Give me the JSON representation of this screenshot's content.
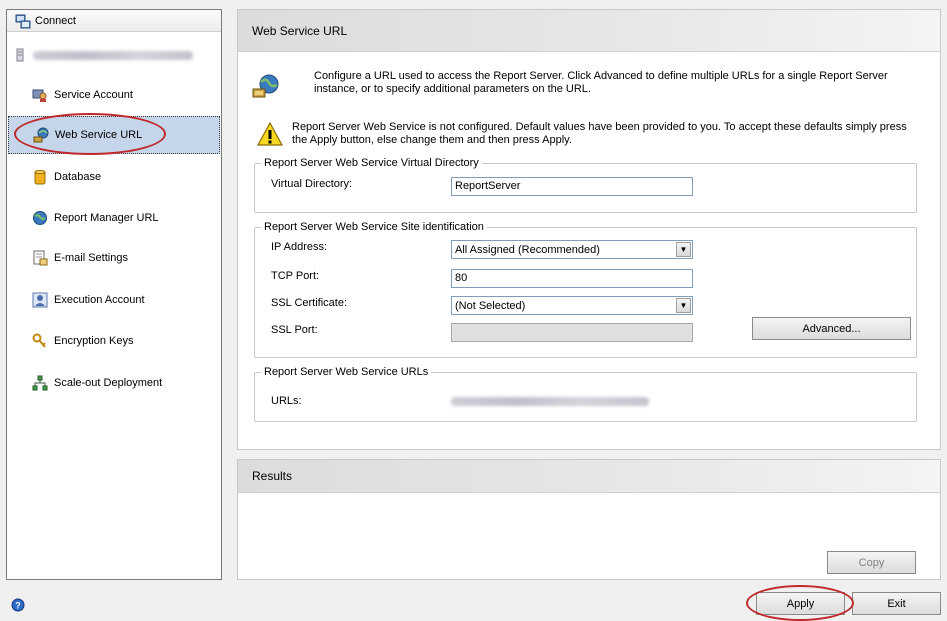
{
  "sidebar": {
    "header": "Connect",
    "items": [
      {
        "label": "Service Account"
      },
      {
        "label": "Web Service URL"
      },
      {
        "label": "Database"
      },
      {
        "label": "Report Manager URL"
      },
      {
        "label": "E-mail Settings"
      },
      {
        "label": "Execution Account"
      },
      {
        "label": "Encryption Keys"
      },
      {
        "label": "Scale-out Deployment"
      }
    ]
  },
  "main": {
    "title": "Web Service URL",
    "info": "Configure a URL used to access the Report Server.  Click Advanced to define multiple URLs for a single Report Server instance, or to specify additional parameters on the URL.",
    "warning": "Report Server Web Service is not configured. Default values have been provided to you. To accept these defaults simply press the Apply button, else change them and then press Apply.",
    "virtual_directory_group": {
      "title": "Report Server Web Service Virtual Directory",
      "label": "Virtual Directory:",
      "value": "ReportServer"
    },
    "site_group": {
      "title": "Report Server Web Service Site identification",
      "ip_label": "IP Address:",
      "ip_value": "All Assigned (Recommended)",
      "tcp_label": "TCP Port:",
      "tcp_value": "80",
      "ssl_cert_label": "SSL Certificate:",
      "ssl_cert_value": "(Not Selected)",
      "ssl_port_label": "SSL Port:",
      "ssl_port_value": "",
      "advanced_label": "Advanced..."
    },
    "urls_group": {
      "title": "Report Server Web Service URLs",
      "label": "URLs:"
    }
  },
  "results": {
    "title": "Results",
    "copy_label": "Copy"
  },
  "footer": {
    "apply_label": "Apply",
    "exit_label": "Exit"
  },
  "colors": {
    "selection": "#c5d5ea",
    "callout": "#c0282a"
  }
}
